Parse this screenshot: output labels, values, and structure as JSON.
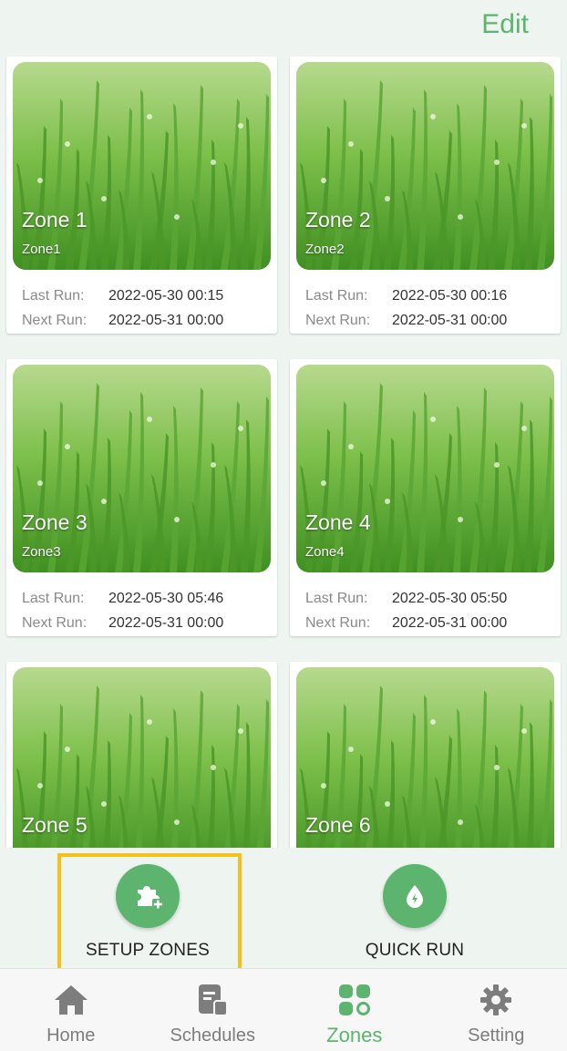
{
  "header": {
    "edit_label": "Edit"
  },
  "colors": {
    "accent": "#5cb46e",
    "highlight": "#f5c018",
    "inactive": "#7d7d7d"
  },
  "labels": {
    "last_run": "Last Run:",
    "next_run": "Next Run:"
  },
  "zones": [
    {
      "name": "Zone 1",
      "sub": "Zone1",
      "last_run": "2022-05-30 00:15",
      "next_run": "2022-05-31 00:00"
    },
    {
      "name": "Zone 2",
      "sub": "Zone2",
      "last_run": "2022-05-30 00:16",
      "next_run": "2022-05-31 00:00"
    },
    {
      "name": "Zone 3",
      "sub": "Zone3",
      "last_run": "2022-05-30 05:46",
      "next_run": "2022-05-31 00:00"
    },
    {
      "name": "Zone 4",
      "sub": "Zone4",
      "last_run": "2022-05-30 05:50",
      "next_run": "2022-05-31 00:00"
    },
    {
      "name": "Zone 5"
    },
    {
      "name": "Zone 6"
    }
  ],
  "actions": {
    "setup": {
      "label": "SETUP ZONES",
      "icon": "puzzle-plus-icon"
    },
    "quick": {
      "label": "QUICK RUN",
      "icon": "water-drop-icon"
    }
  },
  "nav": [
    {
      "label": "Home",
      "icon": "home-icon"
    },
    {
      "label": "Schedules",
      "icon": "schedules-icon"
    },
    {
      "label": "Zones",
      "icon": "zones-icon",
      "active": true
    },
    {
      "label": "Setting",
      "icon": "gear-icon"
    }
  ]
}
